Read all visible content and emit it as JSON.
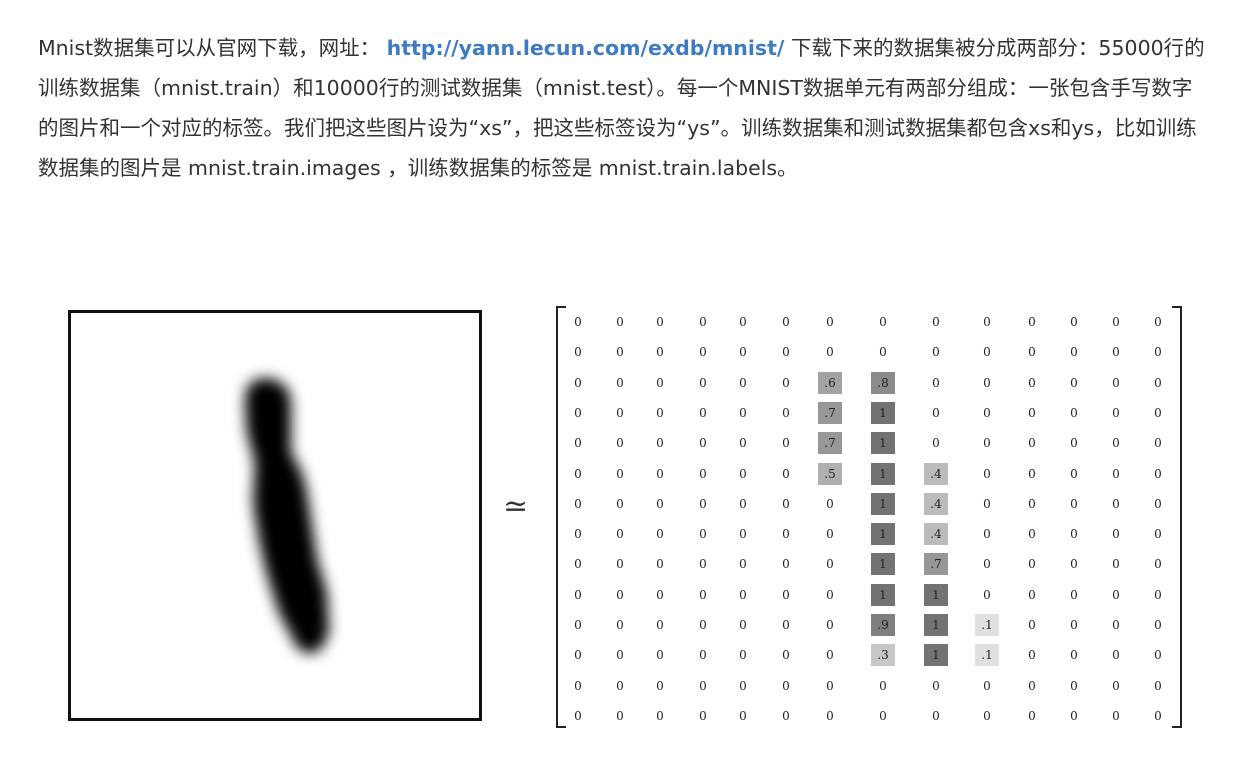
{
  "article": {
    "text_before_link": "Mnist数据集可以从官网下载，网址：",
    "link": "http://yann.lecun.com/exdb/mnist/",
    "text_after_link": " 下载下来的数据集被分成两部分：55000行的训练数据集（mnist.train）和10000行的测试数据集（mnist.test）。每一个MNIST数据单元有两部分组成：一张包含手写数字的图片和一个对应的标签。我们把这些图片设为“xs”，把这些标签设为“ys”。训练数据集和测试数据集都包含xs和ys，比如训练数据集的图片是 mnist.train.images ，训练数据集的标签是 mnist.train.labels。"
  },
  "figure": {
    "approx_symbol": "≃",
    "matrix": [
      [
        "0",
        "0",
        "0",
        "0",
        "0",
        "0",
        "0",
        "0",
        "0",
        "0",
        "0",
        "0",
        "0",
        "0"
      ],
      [
        "0",
        "0",
        "0",
        "0",
        "0",
        "0",
        "0",
        "0",
        "0",
        "0",
        "0",
        "0",
        "0",
        "0"
      ],
      [
        "0",
        "0",
        "0",
        "0",
        "0",
        "0",
        ".6",
        ".8",
        "0",
        "0",
        "0",
        "0",
        "0",
        "0"
      ],
      [
        "0",
        "0",
        "0",
        "0",
        "0",
        "0",
        ".7",
        "1",
        "0",
        "0",
        "0",
        "0",
        "0",
        "0"
      ],
      [
        "0",
        "0",
        "0",
        "0",
        "0",
        "0",
        ".7",
        "1",
        "0",
        "0",
        "0",
        "0",
        "0",
        "0"
      ],
      [
        "0",
        "0",
        "0",
        "0",
        "0",
        "0",
        ".5",
        "1",
        ".4",
        "0",
        "0",
        "0",
        "0",
        "0"
      ],
      [
        "0",
        "0",
        "0",
        "0",
        "0",
        "0",
        "0",
        "1",
        ".4",
        "0",
        "0",
        "0",
        "0",
        "0"
      ],
      [
        "0",
        "0",
        "0",
        "0",
        "0",
        "0",
        "0",
        "1",
        ".4",
        "0",
        "0",
        "0",
        "0",
        "0"
      ],
      [
        "0",
        "0",
        "0",
        "0",
        "0",
        "0",
        "0",
        "1",
        ".7",
        "0",
        "0",
        "0",
        "0",
        "0"
      ],
      [
        "0",
        "0",
        "0",
        "0",
        "0",
        "0",
        "0",
        "1",
        "1",
        "0",
        "0",
        "0",
        "0",
        "0"
      ],
      [
        "0",
        "0",
        "0",
        "0",
        "0",
        "0",
        "0",
        ".9",
        "1",
        ".1",
        "0",
        "0",
        "0",
        "0"
      ],
      [
        "0",
        "0",
        "0",
        "0",
        "0",
        "0",
        "0",
        ".3",
        "1",
        ".1",
        "0",
        "0",
        "0",
        "0"
      ],
      [
        "0",
        "0",
        "0",
        "0",
        "0",
        "0",
        "0",
        "0",
        "0",
        "0",
        "0",
        "0",
        "0",
        "0"
      ],
      [
        "0",
        "0",
        "0",
        "0",
        "0",
        "0",
        "0",
        "0",
        "0",
        "0",
        "0",
        "0",
        "0",
        "0"
      ]
    ]
  }
}
